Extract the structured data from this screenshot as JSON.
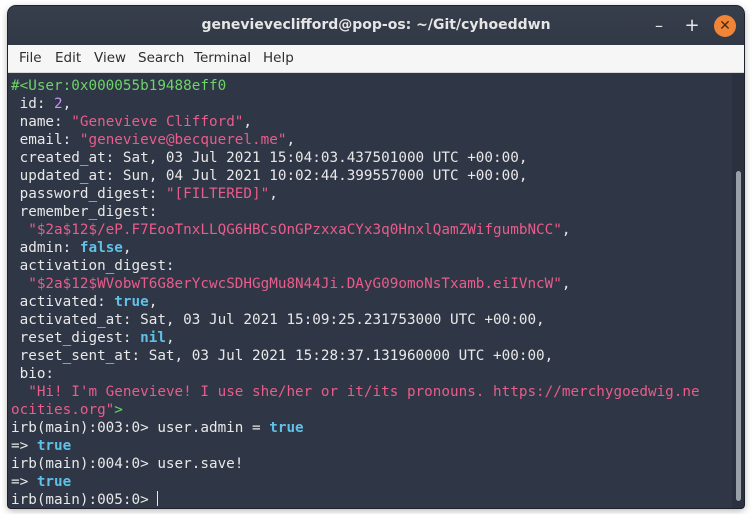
{
  "window": {
    "title": "genevieveclifford@pop-os: ~/Git/cyhoeddwn",
    "minimize_glyph": "–",
    "maximize_glyph": "+",
    "close_glyph": "✕"
  },
  "menu": [
    "File",
    "Edit",
    "View",
    "Search",
    "Terminal",
    "Help"
  ],
  "colors": {
    "background": "#2f3645",
    "string": "#e95c8b",
    "number": "#c692f0",
    "keyword": "#5fc0e8",
    "object_header": "#6fd36a",
    "close_button": "#f08437"
  },
  "terminal": {
    "lines": [
      [
        {
          "t": "#<User:0x000055b19488eff0",
          "c": "c-green"
        }
      ],
      [
        {
          "t": " id: "
        },
        {
          "t": "2",
          "c": "c-num"
        },
        {
          "t": ","
        }
      ],
      [
        {
          "t": " name: "
        },
        {
          "t": "\"Genevieve Clifford\"",
          "c": "c-str"
        },
        {
          "t": ","
        }
      ],
      [
        {
          "t": " email: "
        },
        {
          "t": "\"genevieve@becquerel.me\"",
          "c": "c-str"
        },
        {
          "t": ","
        }
      ],
      [
        {
          "t": " created_at: Sat, 03 Jul 2021 15:04:03.437501000 UTC +00:00,"
        }
      ],
      [
        {
          "t": " updated_at: Sun, 04 Jul 2021 10:02:44.399557000 UTC +00:00,"
        }
      ],
      [
        {
          "t": " password_digest: "
        },
        {
          "t": "\"[FILTERED]\"",
          "c": "c-str"
        },
        {
          "t": ","
        }
      ],
      [
        {
          "t": " remember_digest:"
        }
      ],
      [
        {
          "t": "  "
        },
        {
          "t": "\"$2a$12$/eP.F7EooTnxLLQG6HBCsOnGPzxxaCYx3q0HnxlQamZWifgumbNCC\"",
          "c": "c-str"
        },
        {
          "t": ","
        }
      ],
      [
        {
          "t": " admin: "
        },
        {
          "t": "false",
          "c": "c-kw"
        },
        {
          "t": ","
        }
      ],
      [
        {
          "t": " activation_digest:"
        }
      ],
      [
        {
          "t": "  "
        },
        {
          "t": "\"$2a$12$WVobwT6G8erYcwcSDHGgMu8N44Ji.DAyG09omoNsTxamb.eiIVncW\"",
          "c": "c-str"
        },
        {
          "t": ","
        }
      ],
      [
        {
          "t": " activated: "
        },
        {
          "t": "true",
          "c": "c-kw"
        },
        {
          "t": ","
        }
      ],
      [
        {
          "t": " activated_at: Sat, 03 Jul 2021 15:09:25.231753000 UTC +00:00,"
        }
      ],
      [
        {
          "t": " reset_digest: "
        },
        {
          "t": "nil",
          "c": "c-kw"
        },
        {
          "t": ","
        }
      ],
      [
        {
          "t": " reset_sent_at: Sat, 03 Jul 2021 15:28:37.131960000 UTC +00:00,"
        }
      ],
      [
        {
          "t": " bio:"
        }
      ],
      [
        {
          "t": "  "
        },
        {
          "t": "\"Hi! I'm Genevieve! I use she/her or it/its pronouns. https://merchygoedwig.ne",
          "c": "c-str"
        }
      ],
      [
        {
          "t": "ocities.org\"",
          "c": "c-str"
        },
        {
          "t": ">",
          "c": "c-green"
        }
      ],
      [
        {
          "t": "irb(main):003:0> user.admin = "
        },
        {
          "t": "true",
          "c": "c-kw"
        }
      ],
      [
        {
          "t": "=> "
        },
        {
          "t": "true",
          "c": "c-kw"
        }
      ],
      [
        {
          "t": "irb(main):004:0> user.save!"
        }
      ],
      [
        {
          "t": "=> "
        },
        {
          "t": "true",
          "c": "c-kw"
        }
      ],
      [
        {
          "t": "irb(main):005:0> "
        }
      ]
    ]
  }
}
